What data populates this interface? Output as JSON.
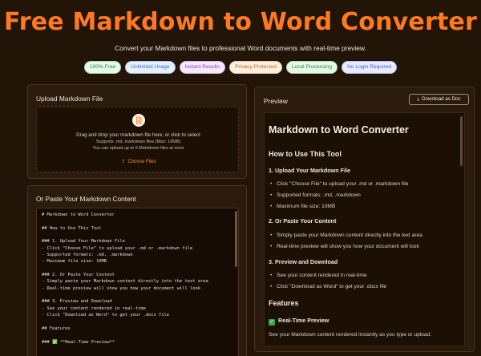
{
  "header": {
    "title": "Free Markdown to Word Converter",
    "subtitle": "Convert your Markdown files to professional Word documents with real-time preview."
  },
  "badges": [
    {
      "label": "100% Free",
      "color": "green"
    },
    {
      "label": "Unlimited Usage",
      "color": "blue"
    },
    {
      "label": "Instant Results",
      "color": "purple"
    },
    {
      "label": "Privacy Protected",
      "color": "orange"
    },
    {
      "label": "Local Processing",
      "color": "green"
    },
    {
      "label": "No Login Required",
      "color": "indigo"
    }
  ],
  "upload": {
    "title": "Upload Markdown File",
    "drop_text": "Drag and drop your markdown file here, or click to select",
    "supports_text": "Supports .md,.markdown files (Max: 10MB)",
    "limit_text": "You can upload up to 5 Markdown files at once",
    "choose_label": "Choose Files",
    "icon": "document-icon"
  },
  "paste": {
    "title": "Or Paste Your Markdown Content",
    "lines": [
      "# Markdown to Word Converter",
      "",
      "## How to Use This Tool",
      "",
      "### 1. Upload Your Markdown File",
      "- Click \"Choose File\" to upload your .md or .markdown file",
      "- Supported formats: .md, .markdown",
      "- Maximum file size: 10MB",
      "",
      "### 2. Or Paste Your Content",
      "- Simply paste your Markdown content directly into the text area",
      "- Real-time preview will show you how your document will look",
      "",
      "### 3. Preview and Download",
      "- See your content rendered in real-time",
      "- Click \"Download as Word\" to get your .docx file",
      "",
      "## Features",
      "",
      "### ✅ **Real-Time Preview**"
    ]
  },
  "preview": {
    "title": "Preview",
    "download_label": "Download as Doc",
    "h1": "Markdown to Word Converter",
    "how_to_heading": "How to Use This Tool",
    "step1_heading": "1. Upload Your Markdown File",
    "step1_items": [
      "Click \"Choose File\" to upload your .md or .markdown file",
      "Supported formats: .md, .markdown",
      "Maximum file size: 10MB"
    ],
    "step2_heading": "2. Or Paste Your Content",
    "step2_items": [
      "Simply paste your Markdown content directly into the text area",
      "Real-time preview will show you how your document will look"
    ],
    "step3_heading": "3. Preview and Download",
    "step3_items": [
      "See your content rendered in real-time",
      "Click \"Download as Word\" to get your .docx file"
    ],
    "features_heading": "Features",
    "realtime_heading": "Real-Time Preview",
    "realtime_text": "See your Markdown content rendered instantly as you type or upload."
  },
  "colors": {
    "accent": "#ff7a1f",
    "background": "#221407",
    "card": "#2b1b0d"
  }
}
